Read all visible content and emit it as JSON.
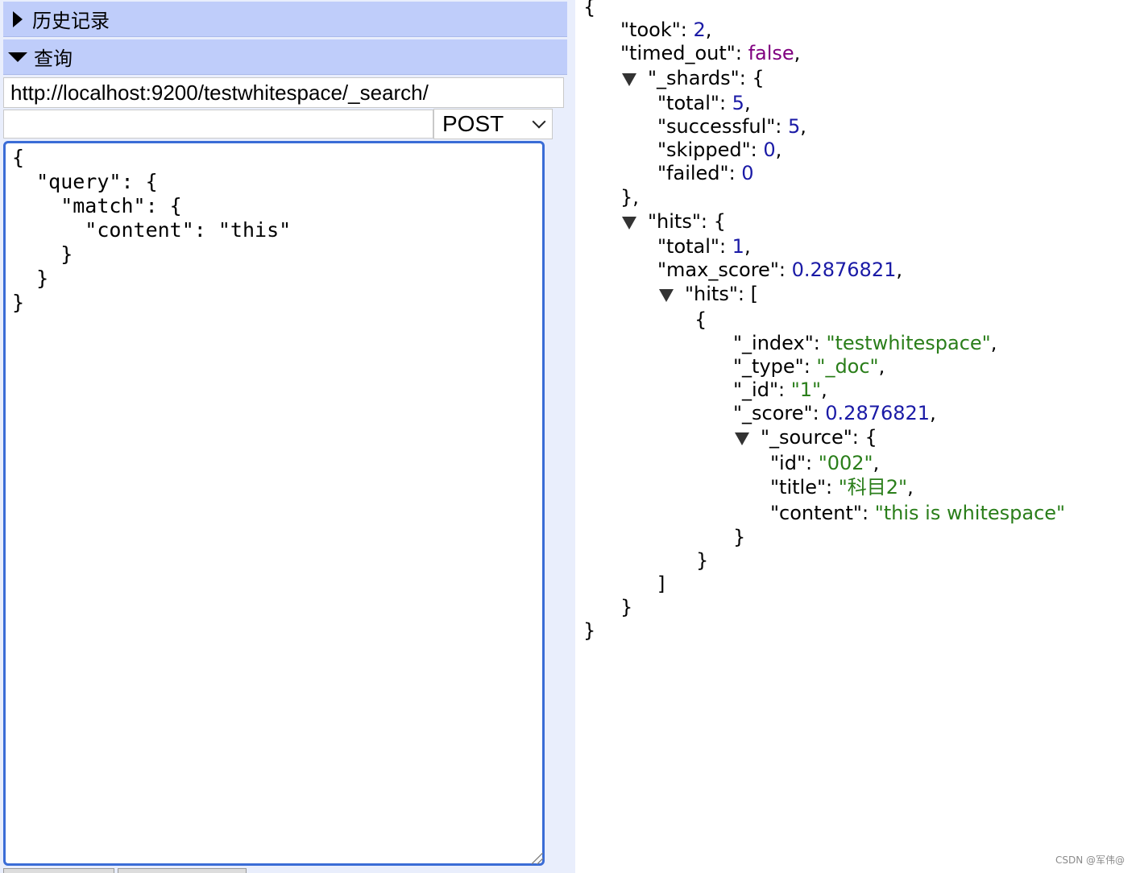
{
  "sections": {
    "history_title": "历史记录",
    "query_title": "查询"
  },
  "request": {
    "url": "http://localhost:9200/testwhitespace/_search/",
    "path": "",
    "method": "POST"
  },
  "body_text": "{\n  \"query\": {\n    \"match\": {\n      \"content\": \"this\"\n    }\n  }\n}",
  "response": {
    "took_key": "\"took\"",
    "took": "2",
    "timed_out_key": "\"timed_out\"",
    "timed_out": "false",
    "shards_key": "\"_shards\"",
    "shards_total": "5",
    "shards_successful": "5",
    "shards_skipped": "0",
    "shards_failed": "0",
    "hits_key": "\"hits\"",
    "hits_total": "1",
    "max_score": "0.2876821",
    "hit": {
      "index": "\"testwhitespace\"",
      "type": "\"_doc\"",
      "id": "\"1\"",
      "score": "0.2876821",
      "source": {
        "id": "\"002\"",
        "title": "\"科目2\"",
        "content": "\"this is whitespace\""
      }
    }
  },
  "footer": {
    "credit": "CSDN @军伟@"
  }
}
